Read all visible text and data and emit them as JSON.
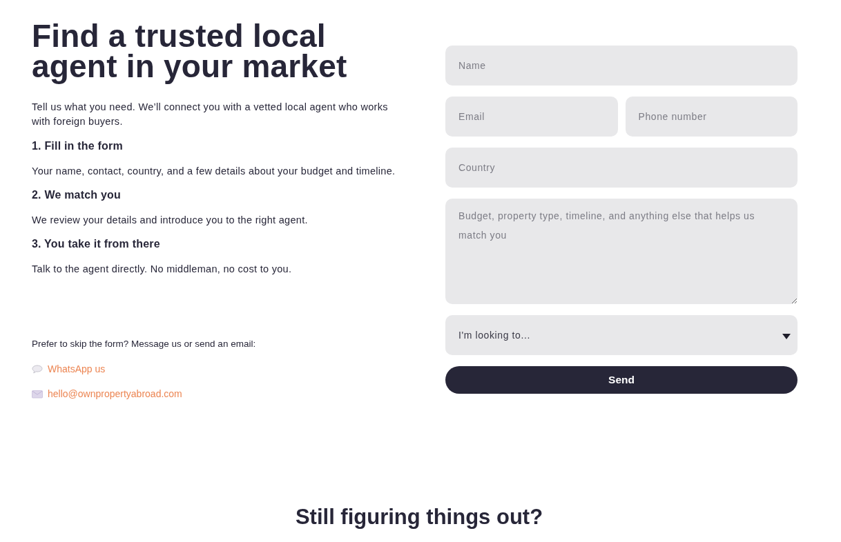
{
  "hero": {
    "title": "Find a trusted local agent in your market",
    "intro": "Tell us what you need. We’ll connect you with a vetted local agent who works with foreign buyers."
  },
  "steps": [
    {
      "title": "1. Fill in the form",
      "text": "Your name, contact, country, and a few details about your budget and timeline."
    },
    {
      "title": "2. We match you",
      "text": "We review your details and introduce you to the right agent."
    },
    {
      "title": "3. You take it from there",
      "text": "Talk to the agent directly. No middleman, no cost to you."
    }
  ],
  "contact": {
    "prompt": "Prefer to skip the form? Message us or send an email:",
    "links": [
      {
        "kind": "chat",
        "label": "WhatsApp us"
      },
      {
        "kind": "email",
        "label": "hello@ownpropertyabroad.com"
      }
    ]
  },
  "form": {
    "rows": [
      {
        "fields": [
          {
            "kind": "text",
            "placeholder": "Name"
          }
        ]
      },
      {
        "fields": [
          {
            "kind": "text",
            "placeholder": "Email"
          },
          {
            "kind": "text",
            "placeholder": "Phone number"
          }
        ]
      },
      {
        "fields": [
          {
            "kind": "text",
            "placeholder": "Country"
          }
        ]
      },
      {
        "fields": [
          {
            "kind": "textarea",
            "placeholder": "Budget, property type, timeline, and anything else that helps us match you"
          }
        ]
      },
      {
        "fields": [
          {
            "kind": "select",
            "value": "I'm looking to..."
          }
        ]
      }
    ],
    "submit": {
      "label": "Send"
    }
  },
  "next_section": {
    "title": "Still figuring things out?"
  }
}
